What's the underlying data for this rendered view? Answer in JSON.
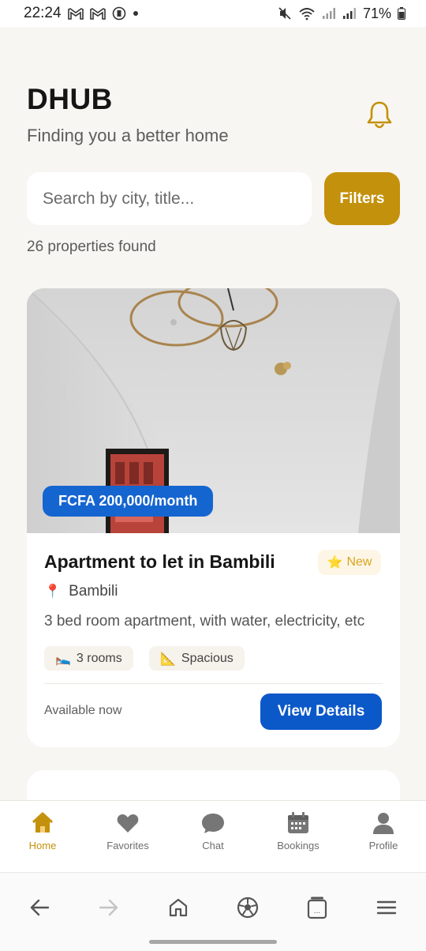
{
  "status_bar": {
    "time": "22:24",
    "battery": "71%",
    "notification_icons": [
      "gmail-icon",
      "gmail-icon",
      "app-icon"
    ]
  },
  "header": {
    "title": "DHUB",
    "subtitle": "Finding you a better home"
  },
  "search": {
    "placeholder": "Search by city, title...",
    "value": "",
    "filters_label": "Filters"
  },
  "results": {
    "count_text": "26 properties found"
  },
  "listing": {
    "price": "FCFA 200,000/month",
    "title": "Apartment to let in Bambili",
    "badge": "New",
    "badge_icon": "⭐",
    "location": "Bambili",
    "location_icon": "📍",
    "description": "3 bed room apartment, with water, electricity, etc",
    "chips": [
      {
        "icon": "🛌",
        "label": "3 rooms"
      },
      {
        "icon": "📐",
        "label": "Spacious"
      }
    ],
    "availability": "Available now",
    "action_label": "View Details"
  },
  "bottom_nav": {
    "items": [
      {
        "label": "Home",
        "icon": "home-icon",
        "active": true
      },
      {
        "label": "Favorites",
        "icon": "heart-icon",
        "active": false
      },
      {
        "label": "Chat",
        "icon": "chat-icon",
        "active": false
      },
      {
        "label": "Bookings",
        "icon": "calendar-icon",
        "active": false
      },
      {
        "label": "Profile",
        "icon": "person-icon",
        "active": false
      }
    ]
  },
  "colors": {
    "accent": "#c4910c",
    "primary_blue": "#0b58c9",
    "background": "#f8f6f2"
  }
}
